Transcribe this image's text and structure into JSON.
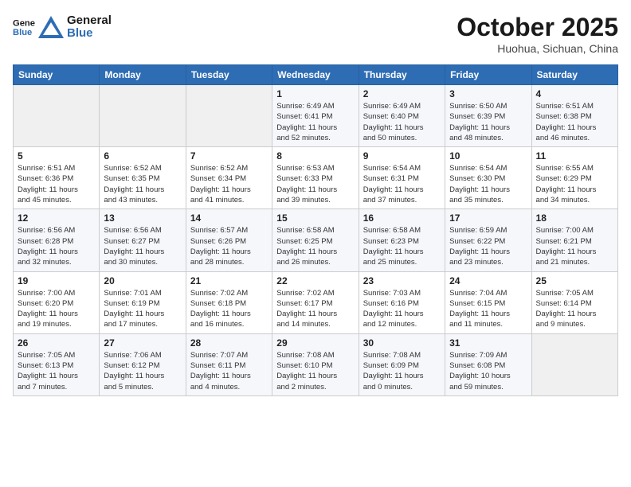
{
  "logo": {
    "line1": "General",
    "line2": "Blue"
  },
  "title": "October 2025",
  "subtitle": "Huohua, Sichuan, China",
  "weekdays": [
    "Sunday",
    "Monday",
    "Tuesday",
    "Wednesday",
    "Thursday",
    "Friday",
    "Saturday"
  ],
  "weeks": [
    [
      {
        "day": "",
        "detail": ""
      },
      {
        "day": "",
        "detail": ""
      },
      {
        "day": "",
        "detail": ""
      },
      {
        "day": "1",
        "detail": "Sunrise: 6:49 AM\nSunset: 6:41 PM\nDaylight: 11 hours\nand 52 minutes."
      },
      {
        "day": "2",
        "detail": "Sunrise: 6:49 AM\nSunset: 6:40 PM\nDaylight: 11 hours\nand 50 minutes."
      },
      {
        "day": "3",
        "detail": "Sunrise: 6:50 AM\nSunset: 6:39 PM\nDaylight: 11 hours\nand 48 minutes."
      },
      {
        "day": "4",
        "detail": "Sunrise: 6:51 AM\nSunset: 6:38 PM\nDaylight: 11 hours\nand 46 minutes."
      }
    ],
    [
      {
        "day": "5",
        "detail": "Sunrise: 6:51 AM\nSunset: 6:36 PM\nDaylight: 11 hours\nand 45 minutes."
      },
      {
        "day": "6",
        "detail": "Sunrise: 6:52 AM\nSunset: 6:35 PM\nDaylight: 11 hours\nand 43 minutes."
      },
      {
        "day": "7",
        "detail": "Sunrise: 6:52 AM\nSunset: 6:34 PM\nDaylight: 11 hours\nand 41 minutes."
      },
      {
        "day": "8",
        "detail": "Sunrise: 6:53 AM\nSunset: 6:33 PM\nDaylight: 11 hours\nand 39 minutes."
      },
      {
        "day": "9",
        "detail": "Sunrise: 6:54 AM\nSunset: 6:31 PM\nDaylight: 11 hours\nand 37 minutes."
      },
      {
        "day": "10",
        "detail": "Sunrise: 6:54 AM\nSunset: 6:30 PM\nDaylight: 11 hours\nand 35 minutes."
      },
      {
        "day": "11",
        "detail": "Sunrise: 6:55 AM\nSunset: 6:29 PM\nDaylight: 11 hours\nand 34 minutes."
      }
    ],
    [
      {
        "day": "12",
        "detail": "Sunrise: 6:56 AM\nSunset: 6:28 PM\nDaylight: 11 hours\nand 32 minutes."
      },
      {
        "day": "13",
        "detail": "Sunrise: 6:56 AM\nSunset: 6:27 PM\nDaylight: 11 hours\nand 30 minutes."
      },
      {
        "day": "14",
        "detail": "Sunrise: 6:57 AM\nSunset: 6:26 PM\nDaylight: 11 hours\nand 28 minutes."
      },
      {
        "day": "15",
        "detail": "Sunrise: 6:58 AM\nSunset: 6:25 PM\nDaylight: 11 hours\nand 26 minutes."
      },
      {
        "day": "16",
        "detail": "Sunrise: 6:58 AM\nSunset: 6:23 PM\nDaylight: 11 hours\nand 25 minutes."
      },
      {
        "day": "17",
        "detail": "Sunrise: 6:59 AM\nSunset: 6:22 PM\nDaylight: 11 hours\nand 23 minutes."
      },
      {
        "day": "18",
        "detail": "Sunrise: 7:00 AM\nSunset: 6:21 PM\nDaylight: 11 hours\nand 21 minutes."
      }
    ],
    [
      {
        "day": "19",
        "detail": "Sunrise: 7:00 AM\nSunset: 6:20 PM\nDaylight: 11 hours\nand 19 minutes."
      },
      {
        "day": "20",
        "detail": "Sunrise: 7:01 AM\nSunset: 6:19 PM\nDaylight: 11 hours\nand 17 minutes."
      },
      {
        "day": "21",
        "detail": "Sunrise: 7:02 AM\nSunset: 6:18 PM\nDaylight: 11 hours\nand 16 minutes."
      },
      {
        "day": "22",
        "detail": "Sunrise: 7:02 AM\nSunset: 6:17 PM\nDaylight: 11 hours\nand 14 minutes."
      },
      {
        "day": "23",
        "detail": "Sunrise: 7:03 AM\nSunset: 6:16 PM\nDaylight: 11 hours\nand 12 minutes."
      },
      {
        "day": "24",
        "detail": "Sunrise: 7:04 AM\nSunset: 6:15 PM\nDaylight: 11 hours\nand 11 minutes."
      },
      {
        "day": "25",
        "detail": "Sunrise: 7:05 AM\nSunset: 6:14 PM\nDaylight: 11 hours\nand 9 minutes."
      }
    ],
    [
      {
        "day": "26",
        "detail": "Sunrise: 7:05 AM\nSunset: 6:13 PM\nDaylight: 11 hours\nand 7 minutes."
      },
      {
        "day": "27",
        "detail": "Sunrise: 7:06 AM\nSunset: 6:12 PM\nDaylight: 11 hours\nand 5 minutes."
      },
      {
        "day": "28",
        "detail": "Sunrise: 7:07 AM\nSunset: 6:11 PM\nDaylight: 11 hours\nand 4 minutes."
      },
      {
        "day": "29",
        "detail": "Sunrise: 7:08 AM\nSunset: 6:10 PM\nDaylight: 11 hours\nand 2 minutes."
      },
      {
        "day": "30",
        "detail": "Sunrise: 7:08 AM\nSunset: 6:09 PM\nDaylight: 11 hours\nand 0 minutes."
      },
      {
        "day": "31",
        "detail": "Sunrise: 7:09 AM\nSunset: 6:08 PM\nDaylight: 10 hours\nand 59 minutes."
      },
      {
        "day": "",
        "detail": ""
      }
    ]
  ]
}
